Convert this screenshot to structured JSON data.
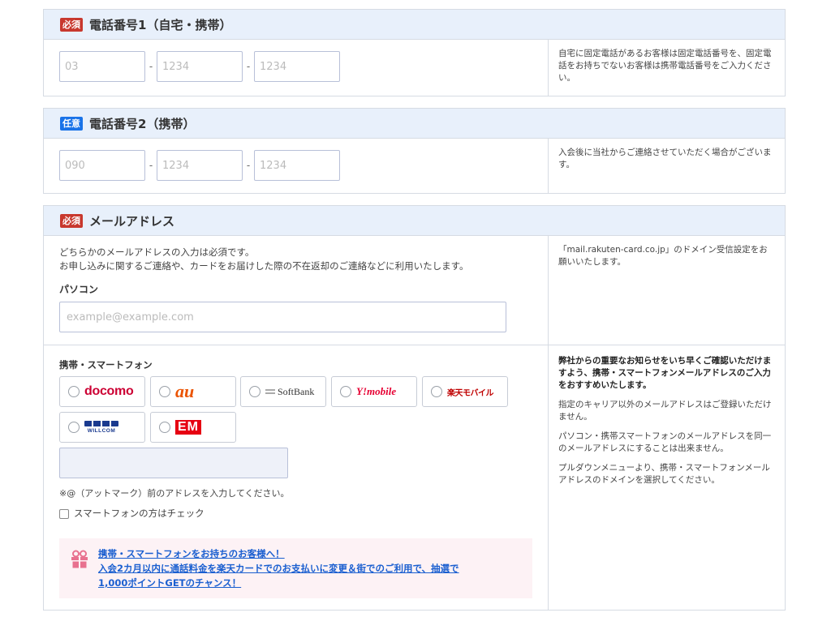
{
  "phone1": {
    "badge": "必須",
    "title": "電話番号1（自宅・携帯）",
    "placeholders": [
      "03",
      "1234",
      "1234"
    ],
    "separator": "-",
    "note": "自宅に固定電話があるお客様は固定電話番号を、固定電話をお持ちでないお客様は携帯電話番号をご入力ください。"
  },
  "phone2": {
    "badge": "任意",
    "title": "電話番号2（携帯）",
    "placeholders": [
      "090",
      "1234",
      "1234"
    ],
    "separator": "-",
    "note": "入会後に当社からご連絡させていただく場合がございます。"
  },
  "email": {
    "badge": "必須",
    "title": "メールアドレス",
    "intro_line1": "どちらかのメールアドレスの入力は必須です。",
    "intro_line2": "お申し込みに関するご連絡や、カードをお届けした際の不在返却のご連絡などに利用いたします。",
    "pc_label": "パソコン",
    "pc_placeholder": "example@example.com",
    "pc_note": "「mail.rakuten-card.co.jp」のドメイン受信設定をお願いいたします。",
    "mobile_label": "携帯・スマートフォン",
    "carriers": [
      "docomo",
      "au",
      "SoftBank",
      "Y!mobile",
      "楽天モバイル",
      "WILLCOM",
      "EM"
    ],
    "mobile_hint": "※@（アットマーク）前のアドレスを入力してください。",
    "smartphone_check": "スマートフォンの方はチェック",
    "promo_line1": "携帯・スマートフォンをお持ちのお客様へ！",
    "promo_line2": "入会2カ月以内に通話料金を楽天カードでのお支払いに変更＆街でのご利用で、抽選で",
    "promo_line3": "1,000ポイントGETのチャンス！",
    "side_note_bold": "弊社からの重要なお知らせをいち早くご確認いただけますよう、携帯・スマートフォンメールアドレスのご入力をおすすめいたします。",
    "side_note_2": "指定のキャリア以外のメールアドレスはご登録いただけません。",
    "side_note_3": "パソコン・携帯スマートフォンのメールアドレスを同一のメールアドレスにすることは出来ません。",
    "side_note_4": "プルダウンメニューより、携帯・スマートフォンメールアドレスのドメインを選択してください。"
  },
  "colors": {
    "required": "#c8382e",
    "optional": "#1a73e8",
    "header_bg": "#e8f0fb",
    "link": "#1a5fd0",
    "docomo": "#cc0033",
    "au": "#eb5505",
    "ymobile": "#e60033",
    "rakuten": "#bf0000",
    "willcom": "#1a3a8f",
    "em": "#e60012"
  }
}
